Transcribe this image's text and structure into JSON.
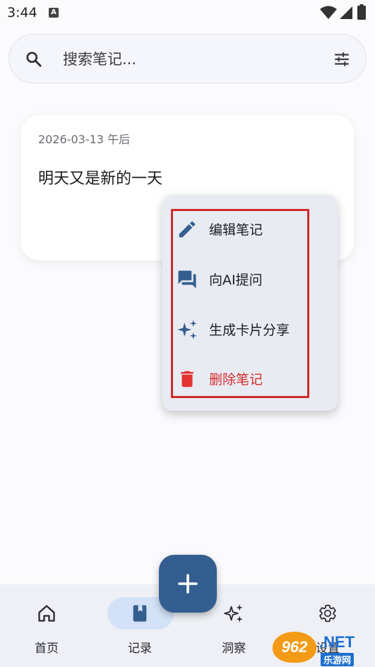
{
  "status_bar": {
    "time": "3:44",
    "notification_icon": "A",
    "icons": [
      "wifi-icon",
      "signal-icon",
      "battery-icon"
    ]
  },
  "search": {
    "placeholder": "搜索笔记...",
    "value": "",
    "icons": [
      "search-icon",
      "filter-icon"
    ]
  },
  "note": {
    "date": "2026-03-13 午后",
    "content": "明天又是新的一天"
  },
  "context_menu": {
    "items": [
      {
        "label": "编辑笔记",
        "icon": "pencil-icon"
      },
      {
        "label": "向AI提问",
        "icon": "chat-icon"
      },
      {
        "label": "生成卡片分享",
        "icon": "sparkle-icon"
      },
      {
        "label": "删除笔记",
        "icon": "trash-icon"
      }
    ],
    "highlight_color": "#d12a2a"
  },
  "fab": {
    "icon": "plus-icon"
  },
  "bottom_nav": {
    "active": "记录",
    "items": [
      {
        "label": "首页",
        "icon": "home-icon"
      },
      {
        "label": "记录",
        "icon": "bookmark-icon"
      },
      {
        "label": "洞察",
        "icon": "sparkle-icon"
      },
      {
        "label": "设置",
        "icon": "gear-icon"
      }
    ]
  },
  "watermark": {
    "badge": "962",
    "net": ".NET",
    "sub": "乐游网"
  },
  "colors": {
    "accent": "#335e8f",
    "nav_pill": "#d3e2f7",
    "danger": "#d42c2c",
    "menu_bg": "#e9ebf3"
  }
}
